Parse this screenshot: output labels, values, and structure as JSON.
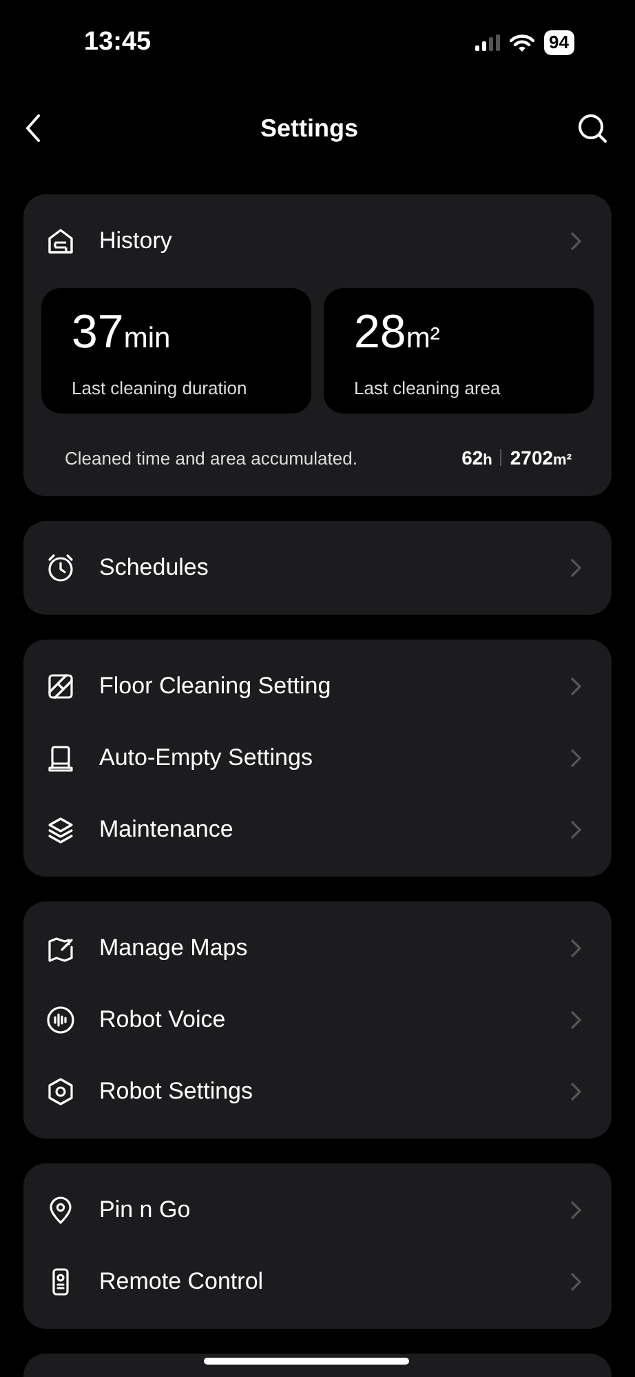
{
  "status_bar": {
    "time": "13:45",
    "battery": "94"
  },
  "nav": {
    "title": "Settings"
  },
  "history": {
    "title": "History",
    "stats": [
      {
        "value": "37",
        "unit": "min",
        "label": "Last cleaning duration"
      },
      {
        "value": "28",
        "unit": "m²",
        "label": "Last cleaning area"
      }
    ],
    "summary": "Cleaned time and area accumulated.",
    "totals": [
      {
        "value": "62",
        "unit": "h"
      },
      {
        "value": "2702",
        "unit": "m²"
      }
    ]
  },
  "groups": [
    [
      {
        "label": "Schedules"
      }
    ],
    [
      {
        "label": "Floor Cleaning Setting"
      },
      {
        "label": "Auto-Empty Settings"
      },
      {
        "label": "Maintenance"
      }
    ],
    [
      {
        "label": "Manage Maps"
      },
      {
        "label": "Robot Voice"
      },
      {
        "label": "Robot Settings"
      }
    ],
    [
      {
        "label": "Pin n Go"
      },
      {
        "label": "Remote Control"
      }
    ]
  ]
}
